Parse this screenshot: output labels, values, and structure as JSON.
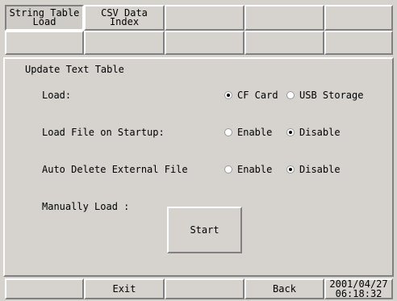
{
  "tabs": [
    {
      "label": "String Table\nLoad",
      "active": true
    },
    {
      "label": "CSV Data Index",
      "active": false
    }
  ],
  "section_title": "Update Text Table",
  "settings": {
    "load": {
      "label": "Load:",
      "options": [
        "CF Card",
        "USB Storage"
      ],
      "selected": "CF Card"
    },
    "startup": {
      "label": "Load File on Startup:",
      "options": [
        "Enable",
        "Disable"
      ],
      "selected": "Disable"
    },
    "auto_delete": {
      "label": "Auto Delete External File",
      "options": [
        "Enable",
        "Disable"
      ],
      "selected": "Disable"
    },
    "manual": {
      "label": "Manually Load :",
      "button_label": "Start"
    }
  },
  "footer": {
    "exit_label": "Exit",
    "back_label": "Back",
    "date": "2001/04/27",
    "time": "06:18:32"
  }
}
